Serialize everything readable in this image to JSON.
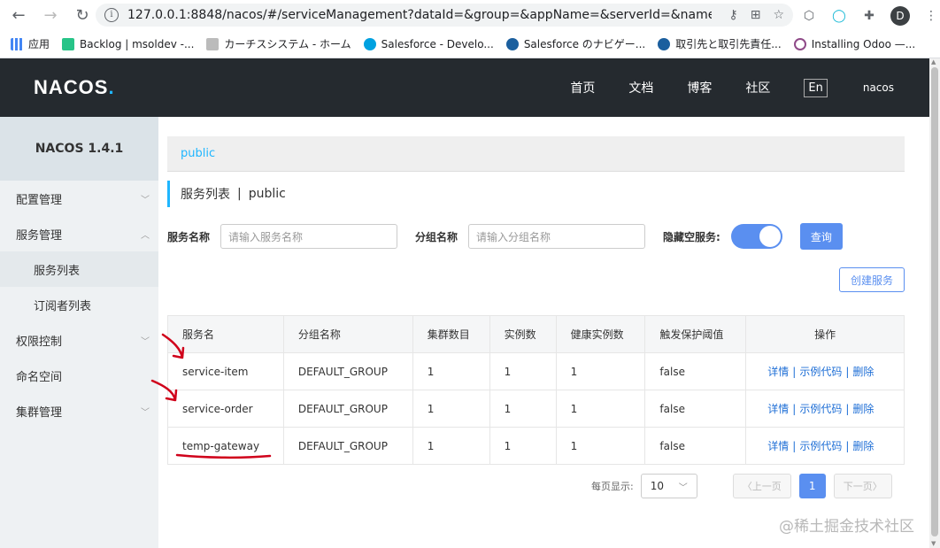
{
  "browser": {
    "url": "127.0.0.1:8848/nacos/#/serviceManagement?dataId=&group=&appName=&serverId=&namespace=&...",
    "profile_initial": "D",
    "bookmarks": [
      {
        "label": "应用",
        "color": "#4285f4"
      },
      {
        "label": "Backlog | msoldev -...",
        "color": "#27c488"
      },
      {
        "label": "カーチスシステム - ホーム",
        "color": "#999999"
      },
      {
        "label": "Salesforce - Develo...",
        "color": "#00a1e0"
      },
      {
        "label": "Salesforce のナビゲー...",
        "color": "#1b5f9e"
      },
      {
        "label": "取引先と取引先責任...",
        "color": "#1b5f9e"
      },
      {
        "label": "Installing Odoo —...",
        "color": "#8f4a88"
      }
    ]
  },
  "header": {
    "logo_main": "NACOS",
    "logo_dot": ".",
    "nav": [
      "首页",
      "文档",
      "博客",
      "社区"
    ],
    "lang": "En",
    "user": "nacos"
  },
  "sidebar": {
    "title": "NACOS 1.4.1",
    "items": [
      {
        "label": "配置管理",
        "chevron": "down"
      },
      {
        "label": "服务管理",
        "chevron": "up"
      },
      {
        "label": "服务列表",
        "sub": true,
        "active": true
      },
      {
        "label": "订阅者列表",
        "sub": true
      },
      {
        "label": "权限控制",
        "chevron": "down"
      },
      {
        "label": "命名空间"
      },
      {
        "label": "集群管理",
        "chevron": "down"
      }
    ]
  },
  "main": {
    "namespace": "public",
    "title": "服务列表",
    "title_sep": "|",
    "title_ns": "public",
    "filters": {
      "service_label": "服务名称",
      "service_placeholder": "请输入服务名称",
      "group_label": "分组名称",
      "group_placeholder": "请输入分组名称",
      "hide_empty_label": "隐藏空服务:",
      "query_button": "查询"
    },
    "create_button": "创建服务",
    "table": {
      "headers": [
        "服务名",
        "分组名称",
        "集群数目",
        "实例数",
        "健康实例数",
        "触发保护阈值",
        "操作"
      ],
      "rows": [
        {
          "name": "service-item",
          "group": "DEFAULT_GROUP",
          "clusters": "1",
          "instances": "1",
          "healthy": "1",
          "threshold": "false"
        },
        {
          "name": "service-order",
          "group": "DEFAULT_GROUP",
          "clusters": "1",
          "instances": "1",
          "healthy": "1",
          "threshold": "false"
        },
        {
          "name": "temp-gateway",
          "group": "DEFAULT_GROUP",
          "clusters": "1",
          "instances": "1",
          "healthy": "1",
          "threshold": "false"
        }
      ],
      "ops": {
        "detail": "详情",
        "sample": "示例代码",
        "delete": "删除",
        "sep": "|"
      }
    },
    "pager": {
      "label": "每页显示:",
      "page_size": "10",
      "prev": "上一页",
      "next": "下一页",
      "current": "1"
    }
  },
  "watermark": "@稀土掘金技术社区"
}
